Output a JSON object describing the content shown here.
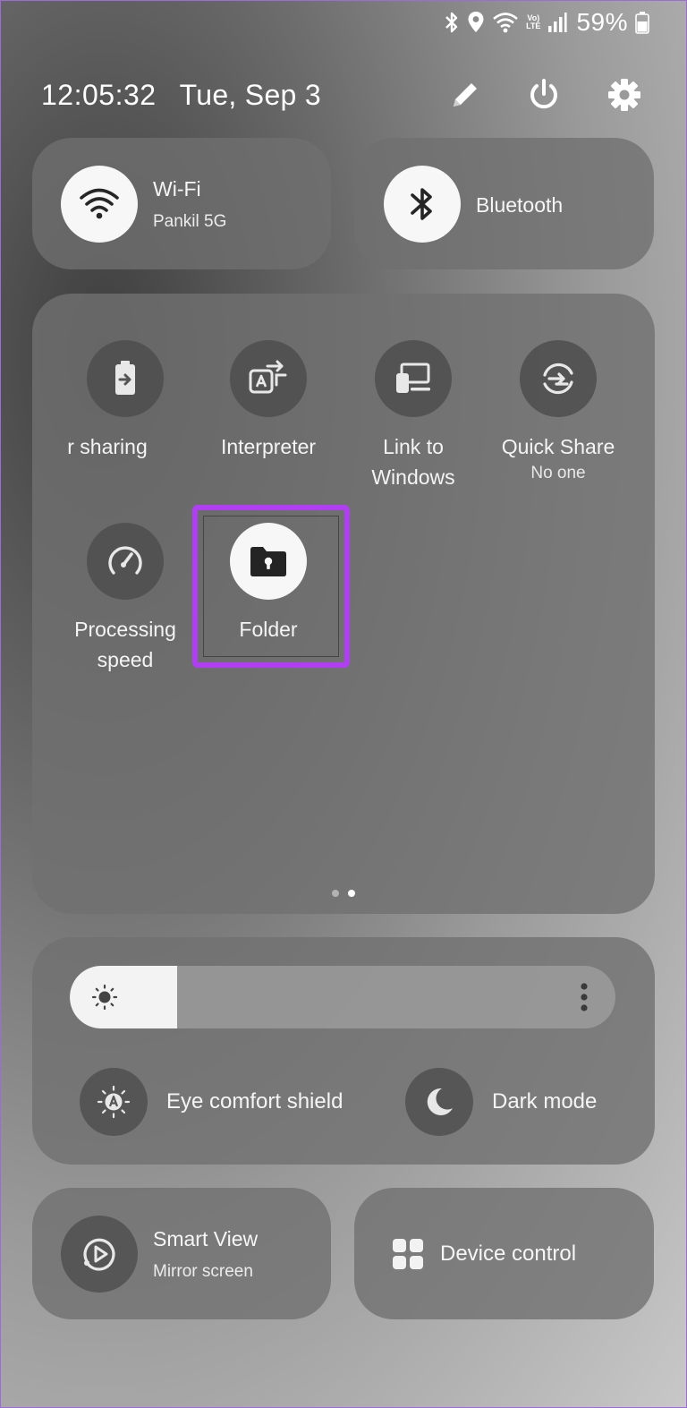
{
  "status_bar": {
    "battery_percent": "59%",
    "network_label": "LTE",
    "network_sub": "Vo)",
    "icons": [
      "bluetooth-icon",
      "location-icon",
      "wifi-icon",
      "volte-icon",
      "signal-icon",
      "battery-icon"
    ]
  },
  "header": {
    "time": "12:05:32",
    "date": "Tue, Sep 3",
    "icons": [
      "pencil-icon",
      "power-icon",
      "gear-icon"
    ]
  },
  "top_tiles": {
    "wifi": {
      "title": "Wi-Fi",
      "subtitle": "Pankil 5G",
      "active": true
    },
    "bluetooth": {
      "title": "Bluetooth",
      "active": true
    }
  },
  "quick_settings": {
    "items": [
      {
        "label": "r sharing",
        "icon": "battery-share-icon",
        "active": false
      },
      {
        "label": "Interpreter",
        "icon": "translate-icon",
        "active": false
      },
      {
        "label": "Link to\nWindows",
        "icon": "link-windows-icon",
        "active": false
      },
      {
        "label": "Quick Share",
        "sublabel": "No one",
        "icon": "quick-share-icon",
        "active": false
      },
      {
        "label": "Processing\nspeed",
        "icon": "speedometer-icon",
        "active": false
      },
      {
        "label": "Folder",
        "icon": "secure-folder-icon",
        "active": true,
        "highlighted": true
      }
    ],
    "page_count": 2,
    "active_page": 2
  },
  "brightness": {
    "level": 0.197,
    "options": [
      {
        "label": "Eye comfort shield",
        "icon": "eye-comfort-icon"
      },
      {
        "label": "Dark mode",
        "icon": "moon-icon"
      }
    ]
  },
  "bottom_tiles": {
    "smart_view": {
      "title": "Smart View",
      "subtitle": "Mirror screen"
    },
    "device_control": {
      "title": "Device control"
    }
  },
  "colors": {
    "highlight": "#b03ff3",
    "tile": "#707070",
    "active_circle": "#f7f7f7"
  }
}
